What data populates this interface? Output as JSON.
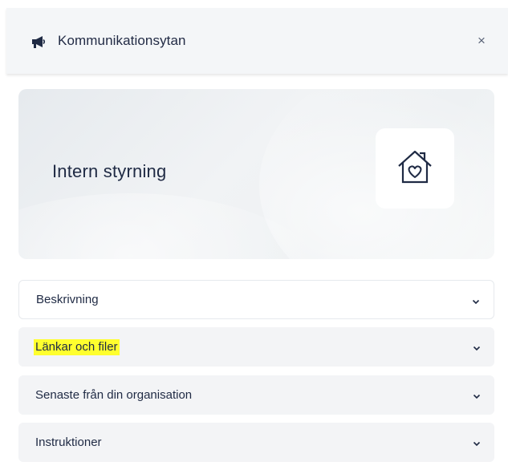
{
  "header": {
    "title": "Kommunikationsytan",
    "icon": "megaphone-icon",
    "close_label": "×"
  },
  "hero": {
    "title": "Intern styrning",
    "icon": "house-heart-icon"
  },
  "accordion": [
    {
      "label": "Beskrivning",
      "highlighted": false
    },
    {
      "label": "Länkar och filer",
      "highlighted": true
    },
    {
      "label": "Senaste från din organisation",
      "highlighted": false
    },
    {
      "label": "Instruktioner",
      "highlighted": false
    }
  ],
  "colors": {
    "text": "#1f2a44",
    "highlight": "#ffff2e",
    "header_bg": "#f4f6f8",
    "row_grey": "#f3f4f6"
  }
}
